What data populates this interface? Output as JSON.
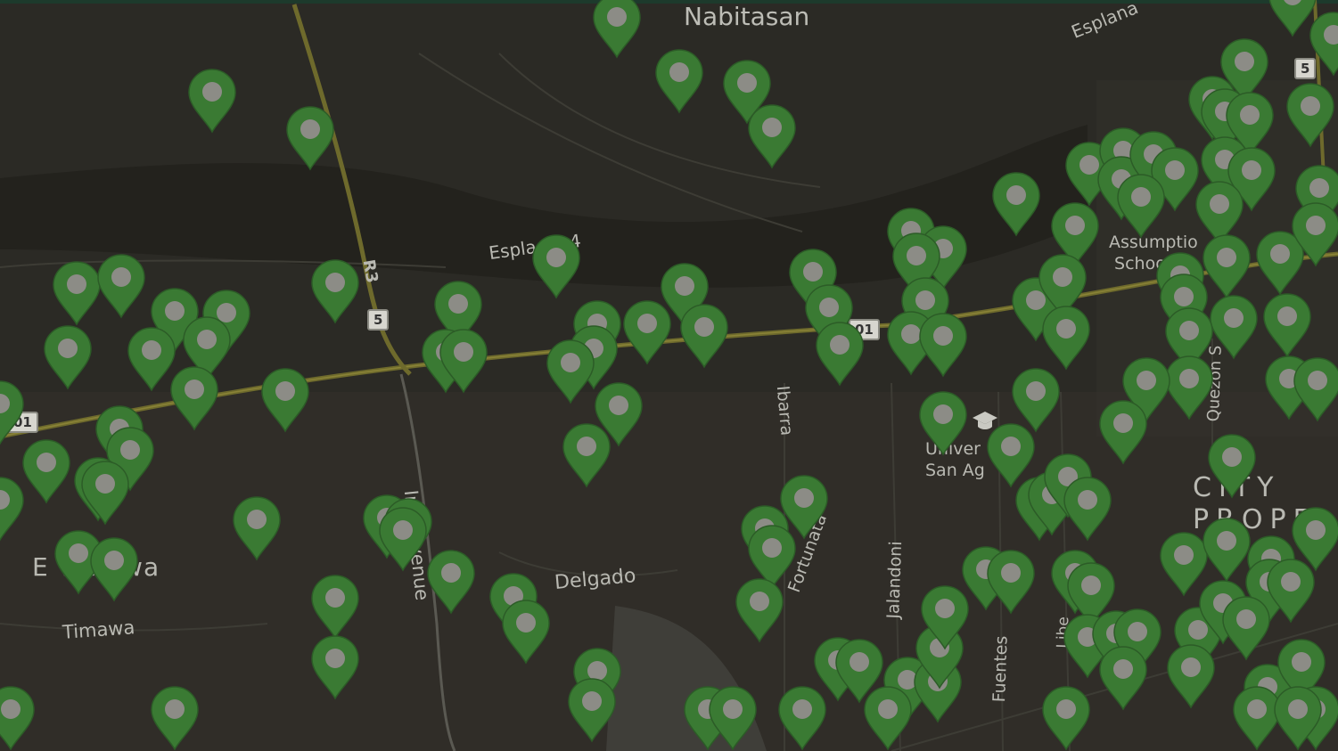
{
  "map": {
    "places": [
      {
        "key": "nabitasan",
        "text": "Nabitasan"
      },
      {
        "key": "esplanade4",
        "text": "Espla      de 4"
      },
      {
        "key": "esplanade_ne",
        "text": "Esplana"
      },
      {
        "key": "ibarra",
        "text": "Ibarra"
      },
      {
        "key": "delgado",
        "text": "Delgado"
      },
      {
        "key": "infante",
        "text": "Infa   Avenue"
      },
      {
        "key": "fortunata",
        "text": "Fortunata"
      },
      {
        "key": "jalandoni",
        "text": "Jalandoni"
      },
      {
        "key": "fuentes",
        "text": "Fuentes"
      },
      {
        "key": "libertad",
        "text": "Libe"
      },
      {
        "key": "quezon",
        "text": "Quezon S"
      },
      {
        "key": "timawa",
        "text": "Timawa"
      },
      {
        "key": "district",
        "text": "E   Timawa"
      },
      {
        "key": "assumption",
        "text": "Assumptio\n School"
      },
      {
        "key": "usa",
        "text": "Univer     f\nSan Ag"
      },
      {
        "key": "cityproper",
        "text": "CITY\nPROPE"
      }
    ],
    "roads": [
      {
        "key": "r3",
        "text": "R3"
      },
      {
        "key": "shield5a",
        "text": "5"
      },
      {
        "key": "shield5b",
        "text": "5"
      },
      {
        "key": "shield01a",
        "text": "01"
      },
      {
        "key": "shield01b",
        "text": "01"
      }
    ],
    "university_icon": "graduation-cap-icon",
    "marker_color": "#3a7a33",
    "marker_center_color": "#8c8c86",
    "marker_count": 150
  }
}
